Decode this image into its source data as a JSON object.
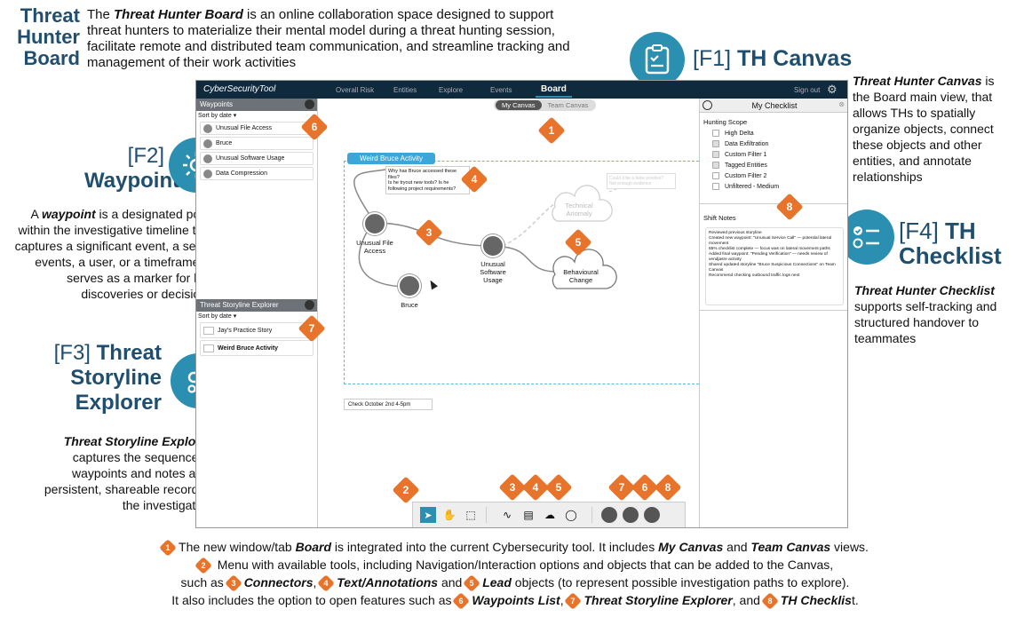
{
  "header": {
    "title_lines": [
      "Threat",
      "Hunter",
      "Board"
    ],
    "intro_prefix": "The ",
    "intro_bold": "Threat Hunter Board",
    "intro_rest": " is an online collaboration space designed to support threat hunters to materialize their mental model during a threat hunting session, facilitate remote and distributed team communication, and streamline tracking and management of their work activities"
  },
  "f1": {
    "tag": "[F1] ",
    "name": "TH Canvas",
    "desc_bold": "Threat Hunter Canvas",
    "desc_rest": " is the Board main view, that allows THs to spatially organize objects, connect these objects and other entities, and annotate relationships"
  },
  "f2": {
    "tag": "[F2]",
    "name": "Waypoints",
    "desc_pre": "A ",
    "desc_bold": "waypoint",
    "desc_rest": " is a designated point within the investigative timeline that captures a significant event, a set of events, a user, or a timeframe. It serves as a marker for key discoveries or decisions"
  },
  "f3": {
    "tag": "[F3] ",
    "name_a": "Threat",
    "name_b": "Storyline",
    "name_c": "Explorer",
    "desc_bold": "Threat Storyline Explorer",
    "desc_rest": " captures the sequence of waypoints and notes as a persistent, shareable record of the investigation"
  },
  "f4": {
    "tag": "[F4] ",
    "name_a": "TH",
    "name_b": "Checklist",
    "desc_bold": "Threat Hunter Checklist",
    "desc_rest": " supports self-tracking and structured handover to teammates"
  },
  "app": {
    "brand": "CyberSecurityTool",
    "nav": [
      "Overall Risk",
      "Entities",
      "Explore",
      "Events",
      "Board"
    ],
    "signout": "Sign out",
    "tabs": [
      "My Canvas",
      "Team Canvas"
    ],
    "waypoints_title": "Waypoints",
    "sort": "Sort by date ▾",
    "waypoints": [
      "Unusual File Access",
      "Bruce",
      "Unusual Software Usage",
      "Data Compression"
    ],
    "explorer_title": "Threat Storyline Explorer",
    "stories": [
      "Jay's Practice Story",
      "Weird Bruce Activity"
    ],
    "group_label": "Weird Bruce Activity",
    "note1": "Why has Bruce accessed these files?\nIs he tryout new tools? Is he following project requirements?",
    "note2": "Could it be a false positive?\nNot enough evidence",
    "node_file": [
      "Unusual File",
      "Access"
    ],
    "node_soft": [
      "Unusual",
      "Software",
      "Usage"
    ],
    "node_bruce": "Bruce",
    "node_tech": [
      "Technical",
      "Anomaly"
    ],
    "node_behav": [
      "Behavioural",
      "Change"
    ],
    "sticky": "Check October 2nd 4-5pm",
    "checklist_title": "My Checklist",
    "scope_label": "Hunting Scope",
    "scope": [
      "High Delta",
      "Data Exfiltration",
      "Custom Filter 1",
      "Tagged Entities",
      "Custom Filter 2",
      "Unfiltered - Medium"
    ],
    "shift_label": "Shift Notes",
    "shift_notes": [
      "Reviewed previous storyline",
      "Created new waypoint: \"Unusual Service Call\" — potential lateral movement",
      "65% checklist complete — focus was on lateral movement paths",
      "Added final waypoint: \"Pending Verification\" — needs review of vendjasre activity",
      "Shared updated storyline \"Bruce Suspicious Connections\" on Team Canvas",
      "Recommend checking outbound traffic logs next"
    ]
  },
  "footer": {
    "line1_pre": "The new window/tab ",
    "line1_b1": "Board",
    "line1_mid": " is integrated into the current Cybersecurity tool. It includes ",
    "line1_b2": "My Canvas",
    "line1_and": " and ",
    "line1_b3": "Team Canvas",
    "line1_end": " views.",
    "line2": " Menu with available tools, including Navigation/Interaction options and objects that can be added to the Canvas,",
    "line3_pre": "such as ",
    "line3_b1": "Connectors",
    "line3_c": ", ",
    "line3_b2": "Text/Annotations",
    "line3_and": " and ",
    "line3_b3": "Lead",
    "line3_end": " objects (to represent possible investigation paths to explore).",
    "line4_pre": "It also includes the option to open features such as ",
    "line4_b1": "Waypoints List",
    "line4_c": ", ",
    "line4_b2": "Threat Storyline Explorer",
    "line4_and": ", and ",
    "line4_b3": "TH Checklis",
    "line4_end": "t."
  },
  "badges": {
    "n1": "1",
    "n2": "2",
    "n3": "3",
    "n4": "4",
    "n5": "5",
    "n6": "6",
    "n7": "7",
    "n8": "8"
  },
  "colors": {
    "accent": "#e8742b",
    "brand": "#1f4e6e",
    "teal": "#2b8fb1",
    "navbar": "#0f2a3c"
  }
}
